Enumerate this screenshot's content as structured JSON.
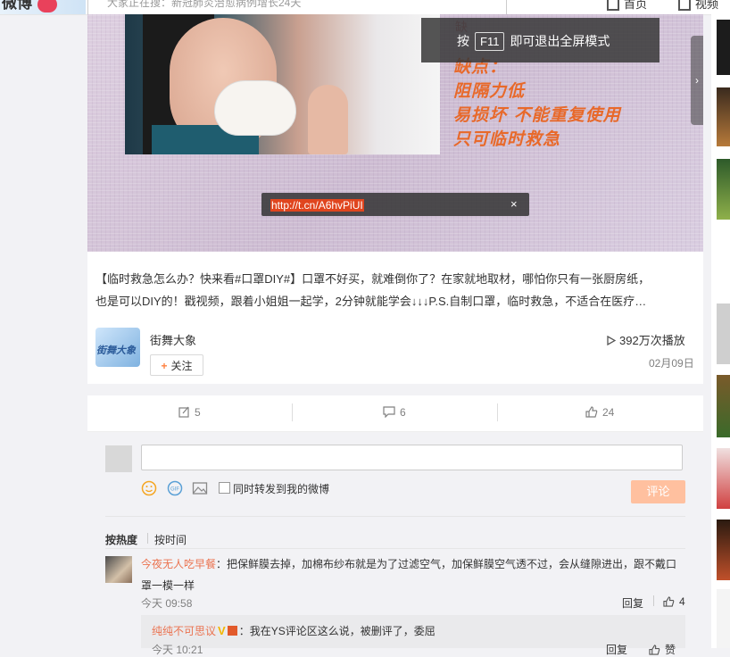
{
  "header": {
    "logo_text": "微博",
    "search_placeholder": "大家正在搜：新冠肺炎治愈病例增长24天",
    "home_label": "首页",
    "video_label": "视频"
  },
  "video": {
    "handwriting_top": "缺",
    "handwriting_lines": [
      "缺点：",
      "阻隔力低",
      "易损坏 不能重复使用",
      "只可临时救急"
    ],
    "fullscreen_hint_prefix": "按",
    "fullscreen_key": "F11",
    "fullscreen_hint_suffix": "即可退出全屏模式",
    "next_arrow": "›",
    "short_url": "http://t.cn/A6hvPiUI",
    "close": "×"
  },
  "post": {
    "text_line1": "【临时救急怎么办？快来看#口罩DIY#】口罩不好买，就难倒你了？在家就地取材，哪怕你只有一张厨房纸，",
    "text_line2": "也是可以DIY的！戳视频，跟着小姐姐一起学，2分钟就能学会↓↓↓P.S.自制口罩，临时救急，不适合在医疗…",
    "author": "街舞大象",
    "author_avatar_text": "街舞大象",
    "follow_label": "关注",
    "plays": "392万次播放",
    "date": "02月09日"
  },
  "actions": {
    "repost_count": "5",
    "comment_count": "6",
    "like_count": "24"
  },
  "comment_box": {
    "input_value": "",
    "repost_option": "同时转发到我的微博",
    "submit_label": "评论"
  },
  "sort": {
    "hot": "按热度",
    "time": "按时间"
  },
  "comments": [
    {
      "user": "今夜无人吃早餐",
      "text": "：把保鲜膜去掉，加棉布纱布就是为了过滤空气，加保鲜膜空气透不过，会从缝隙进出，跟不戴口罩一模一样",
      "time": "今天 09:58",
      "reply_label": "回复",
      "likes": "4",
      "replies": [
        {
          "user": "纯纯不可思议",
          "badge": "V",
          "text": "：我在YS评论区这么说，被删评了，委屈",
          "time": "今天 10:21",
          "reply_label": "回复",
          "like_label": "赞"
        }
      ]
    }
  ],
  "colors": {
    "accent_orange": "#eb7350",
    "submit_disabled": "#ffc09f",
    "handwriting": "#e8692a"
  }
}
